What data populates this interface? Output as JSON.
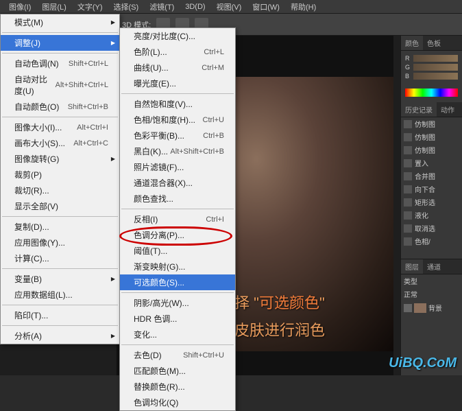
{
  "menubar": [
    "图像(I)",
    "图层(L)",
    "文字(Y)",
    "选择(S)",
    "滤镜(T)",
    "3D(D)",
    "视图(V)",
    "窗口(W)",
    "帮助(H)"
  ],
  "toolbar": {
    "mode_label": "3D 模式:"
  },
  "submenu1": {
    "groups": [
      [
        {
          "label": "模式(M)",
          "sub": true
        }
      ],
      [
        {
          "label": "调整(J)",
          "sub": true,
          "hl": true
        }
      ],
      [
        {
          "label": "自动色调(N)",
          "shortcut": "Shift+Ctrl+L"
        },
        {
          "label": "自动对比度(U)",
          "shortcut": "Alt+Shift+Ctrl+L"
        },
        {
          "label": "自动颜色(O)",
          "shortcut": "Shift+Ctrl+B"
        }
      ],
      [
        {
          "label": "图像大小(I)...",
          "shortcut": "Alt+Ctrl+I"
        },
        {
          "label": "画布大小(S)...",
          "shortcut": "Alt+Ctrl+C"
        },
        {
          "label": "图像旋转(G)",
          "sub": true
        },
        {
          "label": "裁剪(P)"
        },
        {
          "label": "裁切(R)..."
        },
        {
          "label": "显示全部(V)"
        }
      ],
      [
        {
          "label": "复制(D)..."
        },
        {
          "label": "应用图像(Y)..."
        },
        {
          "label": "计算(C)..."
        }
      ],
      [
        {
          "label": "变量(B)",
          "sub": true
        },
        {
          "label": "应用数据组(L)..."
        }
      ],
      [
        {
          "label": "陷印(T)..."
        }
      ],
      [
        {
          "label": "分析(A)",
          "sub": true
        }
      ]
    ]
  },
  "submenu2": {
    "groups": [
      [
        {
          "label": "亮度/对比度(C)..."
        },
        {
          "label": "色阶(L)...",
          "shortcut": "Ctrl+L"
        },
        {
          "label": "曲线(U)...",
          "shortcut": "Ctrl+M"
        },
        {
          "label": "曝光度(E)..."
        }
      ],
      [
        {
          "label": "自然饱和度(V)..."
        },
        {
          "label": "色相/饱和度(H)...",
          "shortcut": "Ctrl+U"
        },
        {
          "label": "色彩平衡(B)...",
          "shortcut": "Ctrl+B"
        },
        {
          "label": "黑白(K)...",
          "shortcut": "Alt+Shift+Ctrl+B"
        },
        {
          "label": "照片滤镜(F)..."
        },
        {
          "label": "通道混合器(X)..."
        },
        {
          "label": "颜色查找..."
        }
      ],
      [
        {
          "label": "反相(I)",
          "shortcut": "Ctrl+I"
        },
        {
          "label": "色调分离(P)..."
        },
        {
          "label": "阈值(T)..."
        },
        {
          "label": "渐变映射(G)..."
        },
        {
          "label": "可选颜色(S)...",
          "hl": true
        }
      ],
      [
        {
          "label": "阴影/高光(W)..."
        },
        {
          "label": "HDR 色调..."
        },
        {
          "label": "变化..."
        }
      ],
      [
        {
          "label": "去色(D)",
          "shortcut": "Shift+Ctrl+U"
        },
        {
          "label": "匹配颜色(M)..."
        },
        {
          "label": "替换颜色(R)..."
        },
        {
          "label": "色调均化(Q)"
        }
      ]
    ]
  },
  "panels": {
    "color_tabs": [
      "颜色",
      "色板"
    ],
    "channels": [
      "R",
      "G",
      "B"
    ],
    "history_tabs": [
      "历史记录",
      "动作"
    ],
    "history_items": [
      "仿制图",
      "仿制图",
      "仿制图",
      "置入",
      "合并图",
      "向下合",
      "矩形选",
      "液化",
      "取消选",
      "色相/"
    ],
    "layers_tabs": [
      "图层",
      "通道"
    ],
    "type_label": "类型",
    "blend_mode": "正常",
    "layer_name": "背景"
  },
  "instruction": {
    "line1_pre": "选择 \"",
    "line1_hl": "可选颜色",
    "line1_post": "\"",
    "line2": "对皮肤进行润色"
  },
  "watermark": "UiBQ.CoM"
}
